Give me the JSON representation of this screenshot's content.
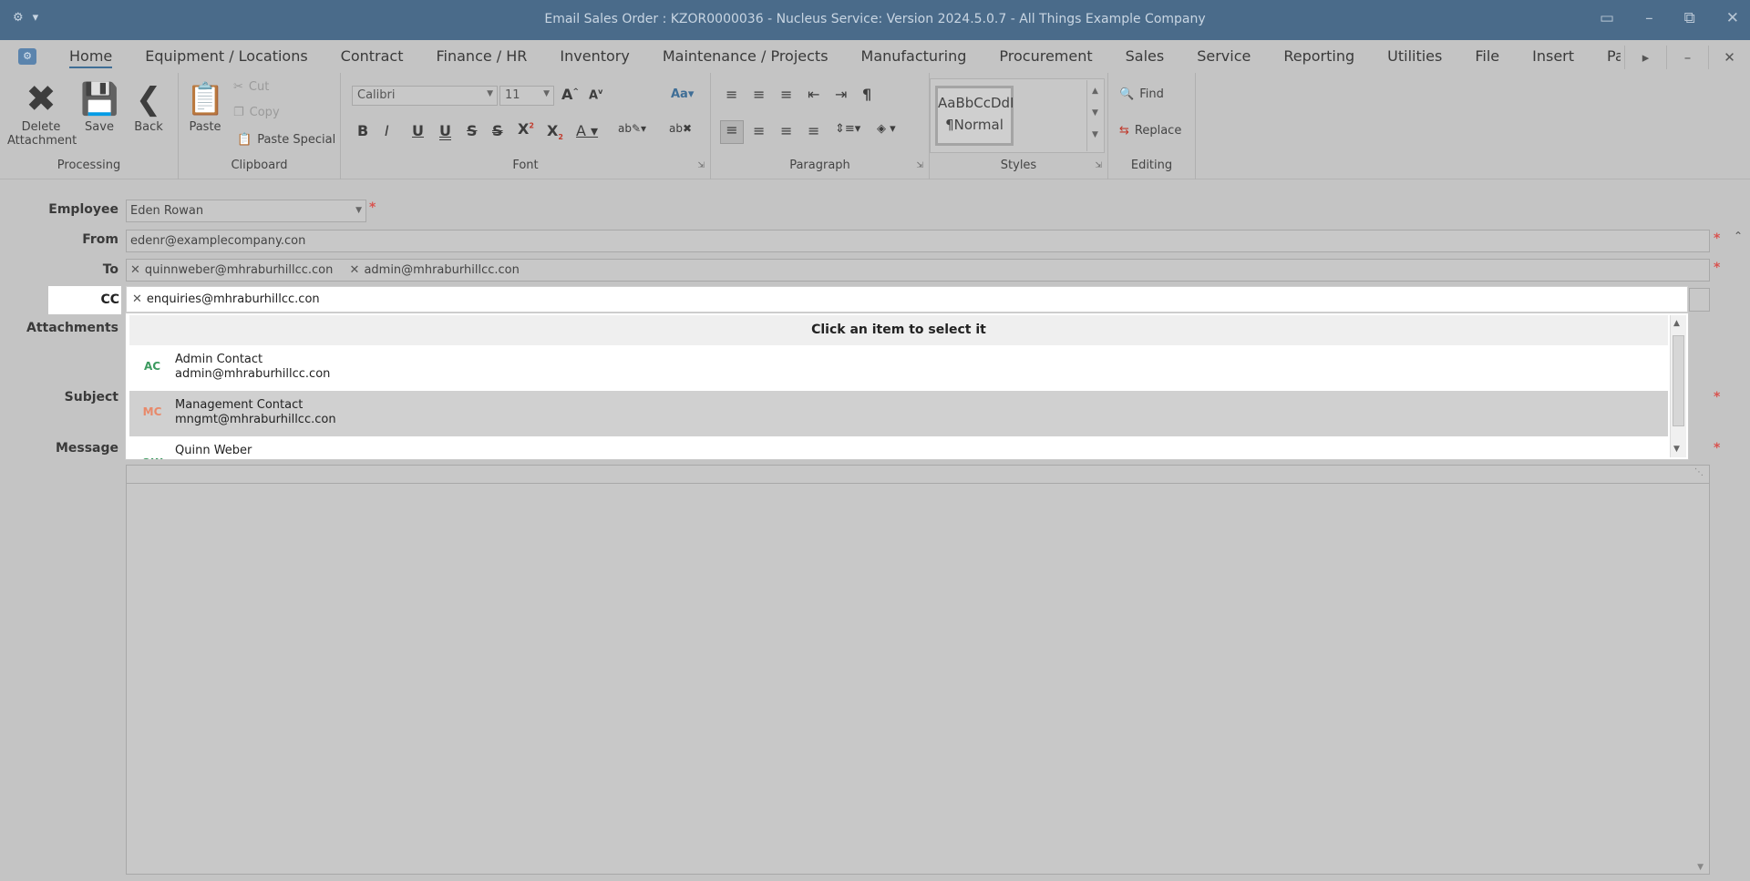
{
  "window": {
    "title": "Email Sales Order : KZOR0000036 - Nucleus Service: Version 2024.5.0.7 - All Things Example Company"
  },
  "menu": {
    "tabs": [
      "Home",
      "Equipment / Locations",
      "Contract",
      "Finance / HR",
      "Inventory",
      "Maintenance / Projects",
      "Manufacturing",
      "Procurement",
      "Sales",
      "Service",
      "Reporting",
      "Utilities",
      "File",
      "Insert",
      "Page Layout"
    ],
    "active": "Home"
  },
  "ribbon": {
    "processing": {
      "label": "Processing",
      "delete": "Delete Attachment",
      "save": "Save",
      "back": "Back"
    },
    "clipboard": {
      "label": "Clipboard",
      "paste": "Paste",
      "cut": "Cut",
      "copy": "Copy",
      "paste_special": "Paste Special"
    },
    "font": {
      "label": "Font",
      "family": "Calibri",
      "size": "11"
    },
    "paragraph": {
      "label": "Paragraph"
    },
    "styles": {
      "label": "Styles",
      "preview": "AaBbCcDdI",
      "name": "¶Normal"
    },
    "editing": {
      "label": "Editing",
      "find": "Find",
      "replace": "Replace"
    }
  },
  "form": {
    "employee": {
      "label": "Employee",
      "value": "Eden Rowan"
    },
    "from": {
      "label": "From",
      "value": "edenr@examplecompany.con"
    },
    "to": {
      "label": "To",
      "recipients": [
        "quinnweber@mhraburhillcc.con",
        "admin@mhraburhillcc.con"
      ]
    },
    "cc": {
      "label": "CC",
      "recipients": [
        "enquiries@mhraburhillcc.con"
      ]
    },
    "attachments": {
      "label": "Attachments"
    },
    "subject": {
      "label": "Subject"
    },
    "message": {
      "label": "Message"
    }
  },
  "dropdown": {
    "header": "Click an item to select it",
    "items": [
      {
        "initials": "AC",
        "name": "Admin Contact",
        "email": "admin@mhraburhillcc.con",
        "color": "#3c9a5f",
        "selected": false
      },
      {
        "initials": "MC",
        "name": "Management Contact",
        "email": "mngmt@mhraburhillcc.con",
        "color": "#e8896a",
        "selected": true
      },
      {
        "initials": "QW",
        "name": "Quinn Weber",
        "email": "",
        "color": "#3c9a5f",
        "selected": false
      }
    ]
  }
}
